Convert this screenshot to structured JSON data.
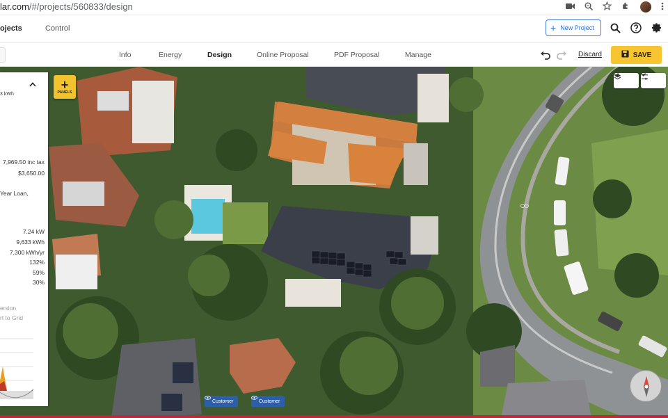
{
  "browser": {
    "url_host": "lar.com",
    "url_path": "/#/projects/560833/design"
  },
  "header": {
    "nav_projects": "ojects",
    "nav_control": "Control",
    "new_project_label": "New Project"
  },
  "tabs": [
    {
      "label": "Info"
    },
    {
      "label": "Energy"
    },
    {
      "label": "Design"
    },
    {
      "label": "Online Proposal"
    },
    {
      "label": "PDF Proposal"
    },
    {
      "label": "Manage"
    }
  ],
  "toolbar": {
    "discard_label": "Discard",
    "save_label": "SAVE"
  },
  "map": {
    "panels_label": "PANELS",
    "customer_badges": [
      "Customer",
      "Customer"
    ]
  },
  "summary": {
    "top_unit": "3 kWh",
    "price_inc_tax": "7,969.50 inc tax",
    "price_2": "$3,650.00",
    "loan_label": "Year Loan,",
    "system_size": "7.24 kW",
    "annual_output": "9,633 kWh",
    "consumption": "7,300 kWh/yr",
    "pct_1": "132%",
    "pct_2": "59%",
    "pct_3": "30%",
    "legend_1": "ersion",
    "legend_2": "rt to Grid"
  },
  "colors": {
    "accent_yellow": "#f7c531",
    "link_blue": "#2f6fcf",
    "customer_blue": "#2c5fa8"
  }
}
